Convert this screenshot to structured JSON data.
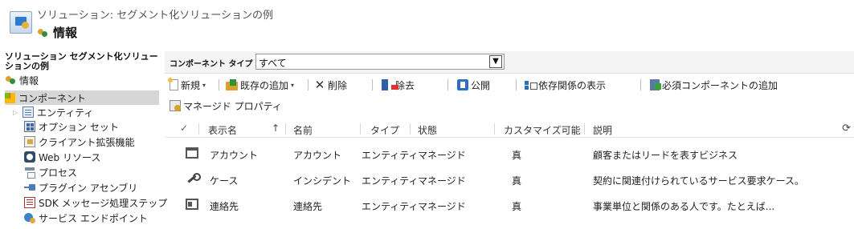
{
  "header": {
    "subtitle": "ソリューション: セグメント化ソリューションの例",
    "title": "情報"
  },
  "nav": {
    "solution_title": "ソリューション セグメント化ソリューションの例",
    "info_label": "情報",
    "components_label": "コンポーネント",
    "items": [
      {
        "label": "エンティティ",
        "icon": "entity-icon"
      },
      {
        "label": "オプション セット",
        "icon": "option-set-icon"
      },
      {
        "label": "クライアント拡張機能",
        "icon": "client-extension-icon"
      },
      {
        "label": "Web リソース",
        "icon": "web-resource-icon"
      },
      {
        "label": "プロセス",
        "icon": "process-icon"
      },
      {
        "label": "プラグイン アセンブリ",
        "icon": "plugin-assembly-icon"
      },
      {
        "label": "SDK メッセージ処理ステップ",
        "icon": "sdk-step-icon"
      },
      {
        "label": "サービス エンドポイント",
        "icon": "service-endpoint-icon"
      }
    ]
  },
  "filter": {
    "label": "コンポーネント タイプ",
    "selected": "すべて"
  },
  "toolbar": {
    "new_label": "新規",
    "add_existing_label": "既存の追加",
    "delete_label": "削除",
    "remove_label": "除去",
    "publish_label": "公開",
    "show_dependencies_label": "依存関係の表示",
    "add_required_label": "必須コンポーネントの追加",
    "managed_properties_label": "マネージド プロパティ"
  },
  "grid": {
    "columns": [
      "表示名",
      "名前",
      "タイプ",
      "状態",
      "カスタマイズ可能",
      "説明"
    ],
    "rows": [
      {
        "icon": "account-icon",
        "display_name": "アカウント",
        "name": "アカウント",
        "type": "エンティティ",
        "state": "マネージド",
        "customizable": "真",
        "description": "顧客またはリードを表すビジネス"
      },
      {
        "icon": "case-icon",
        "display_name": "ケース",
        "name": "インシデント",
        "type": "エンティティ",
        "state": "マネージド",
        "customizable": "真",
        "description": "契約に関連付けられているサービス要求ケース。"
      },
      {
        "icon": "contact-icon",
        "display_name": "連絡先",
        "name": "連絡先",
        "type": "エンティティ",
        "state": "マネージド",
        "customizable": "真",
        "description": "事業単位と関係のある人です。たとえば..."
      }
    ]
  }
}
